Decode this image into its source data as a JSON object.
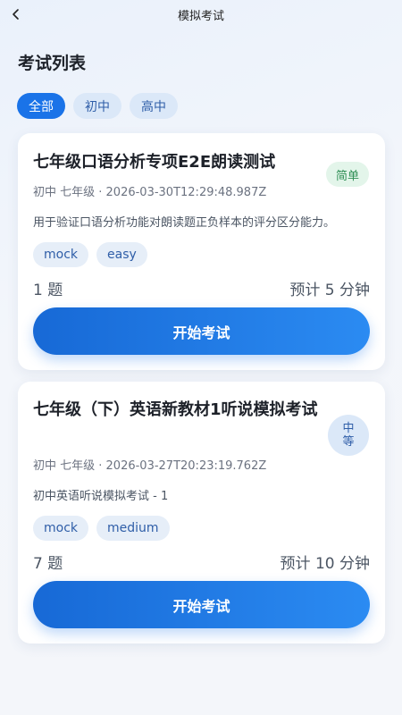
{
  "header": {
    "title": "模拟考试",
    "back_icon": "chevron-left-icon"
  },
  "page": {
    "title": "考试列表"
  },
  "filters": [
    {
      "label": "全部",
      "active": true
    },
    {
      "label": "初中",
      "active": false
    },
    {
      "label": "高中",
      "active": false
    }
  ],
  "exams": [
    {
      "title": "七年级口语分析专项E2E朗读测试",
      "difficulty": "简单",
      "meta": "初中 七年级 · 2026-03-30T12:29:48.987Z",
      "description": "用于验证口语分析功能对朗读题正负样本的评分区分能力。",
      "tags": [
        "mock",
        "easy"
      ],
      "question_count": "1 题",
      "estimate": "预计 5 分钟",
      "start_label": "开始考试"
    },
    {
      "title": "七年级（下）英语新教材1听说模拟考试",
      "difficulty_line1": "中",
      "difficulty_line2": "等",
      "meta": "初中 七年级 · 2026-03-27T20:23:19.762Z",
      "description": "初中英语听说模拟考试 - 1",
      "tags": [
        "mock",
        "medium"
      ],
      "question_count": "7 题",
      "estimate": "预计 10 分钟",
      "start_label": "开始考试"
    }
  ],
  "colors": {
    "accent": "#1a73e8",
    "easy_bg": "#e3f5ea",
    "easy_text": "#2f8f55"
  }
}
